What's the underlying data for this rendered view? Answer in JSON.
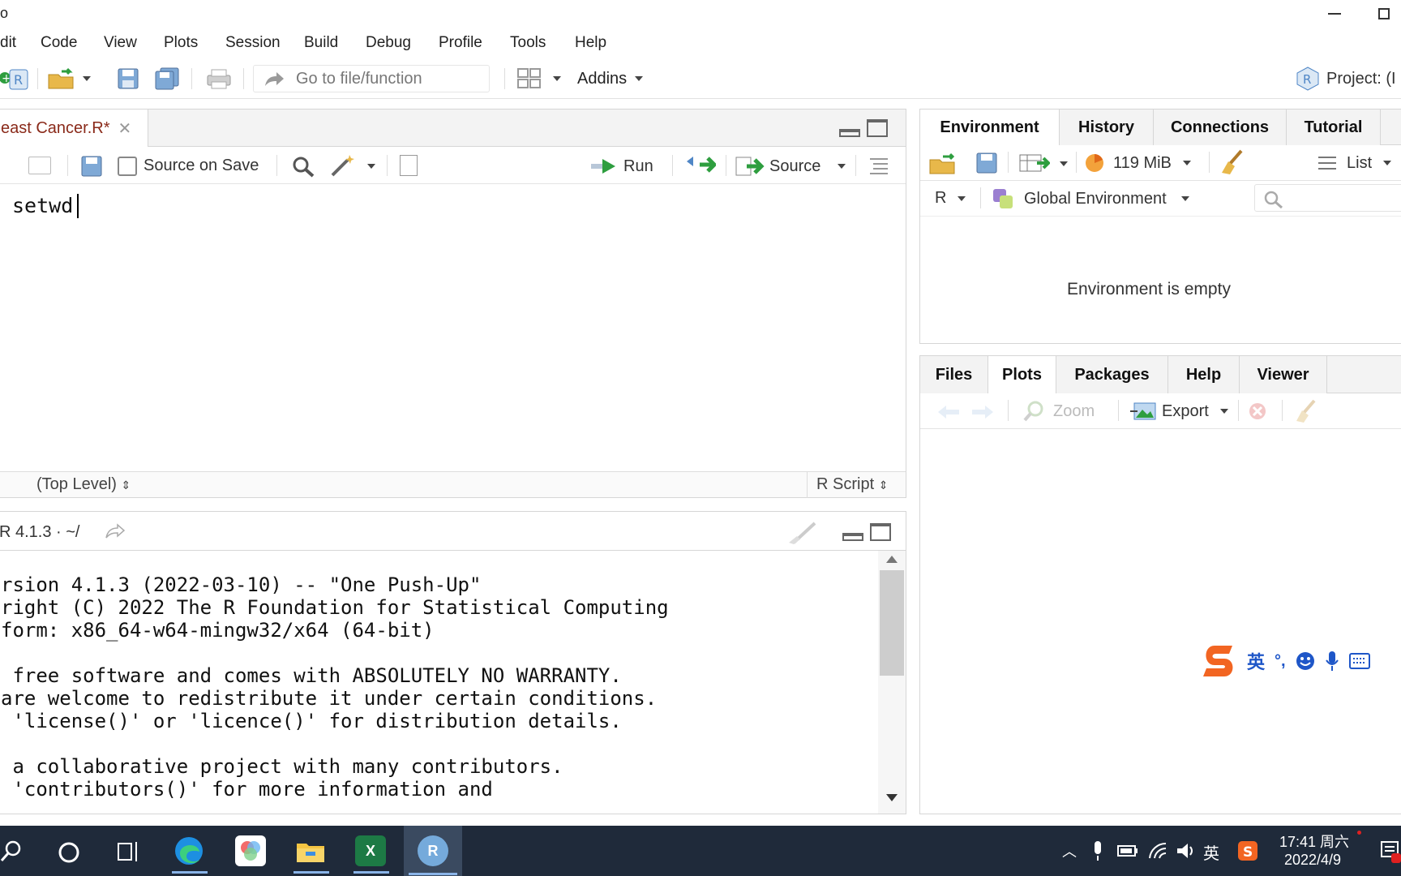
{
  "window": {
    "title_fragment": "o"
  },
  "menu": [
    "dit",
    "Code",
    "View",
    "Plots",
    "Session",
    "Build",
    "Debug",
    "Profile",
    "Tools",
    "Help"
  ],
  "toolbar": {
    "goto_placeholder": "Go to file/function",
    "addins_label": "Addins",
    "project_label": "Project: (I"
  },
  "editor": {
    "tab_label": "east Cancer.R*",
    "source_on_save_label": "Source on Save",
    "run_label": "Run",
    "source_label": "Source",
    "code_line": "setwd",
    "status_scope": "(Top Level)",
    "status_type": "R Script"
  },
  "console": {
    "header": "R 4.1.3 · ~/",
    "lines": [
      "rsion 4.1.3 (2022-03-10) -- \"One Push-Up\"",
      "right (C) 2022 The R Foundation for Statistical Computing",
      "form: x86_64-w64-mingw32/x64 (64-bit)",
      "",
      " free software and comes with ABSOLUTELY NO WARRANTY.",
      "are welcome to redistribute it under certain conditions.",
      " 'license()' or 'licence()' for distribution details.",
      "",
      " a collaborative project with many contributors.",
      " 'contributors()' for more information and"
    ]
  },
  "env_pane": {
    "tabs": [
      "Environment",
      "History",
      "Connections",
      "Tutorial"
    ],
    "memory_label": "119 MiB",
    "list_label": "List",
    "lang_label": "R",
    "scope_label": "Global Environment",
    "empty_message": "Environment is empty"
  },
  "files_pane": {
    "tabs": [
      "Files",
      "Plots",
      "Packages",
      "Help",
      "Viewer"
    ],
    "zoom_label": "Zoom",
    "export_label": "Export"
  },
  "ime": {
    "lang": "英",
    "punct": "°,"
  },
  "taskbar": {
    "time": "17:41 周六",
    "date": "2022/4/9",
    "ime_label": "英",
    "excel_label": "X",
    "r_label": "R"
  },
  "colors": {
    "accent_green": "#2e9e3f",
    "r_blue": "#4f86c6",
    "taskbar_bg": "#1f2a3a",
    "editor_tab_text": "#8a2a1a"
  }
}
